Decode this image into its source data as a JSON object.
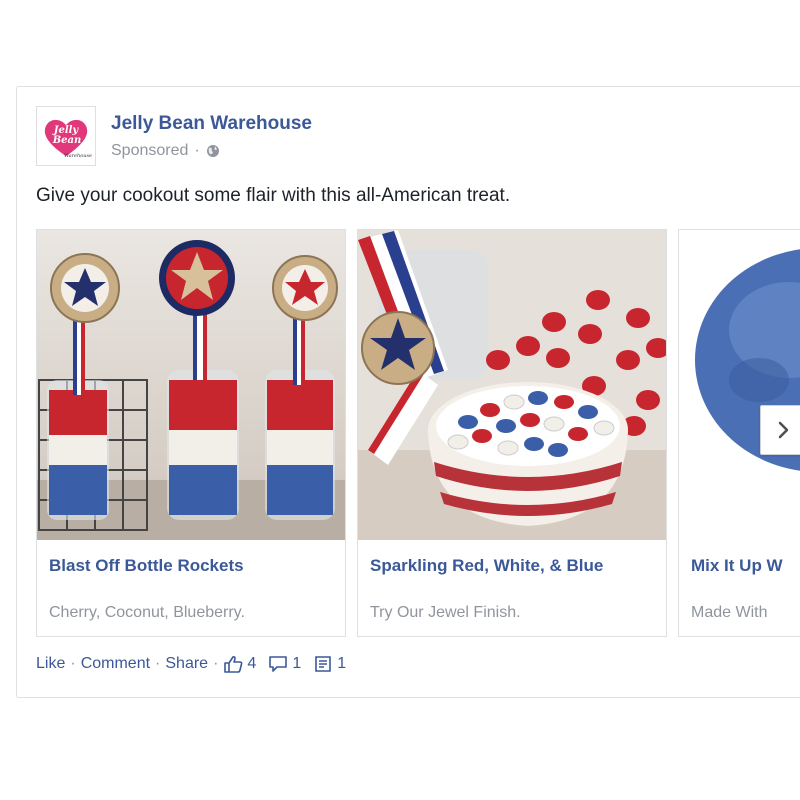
{
  "post": {
    "page_name": "Jelly Bean Warehouse",
    "sponsored": "Sponsored",
    "separator_dot": "·",
    "text": "Give your cookout some flair with this all-American treat.",
    "logo_text": {
      "line1": "Jelly",
      "line2": "Bean",
      "line3": "Warehouse"
    }
  },
  "carousel": {
    "cards": [
      {
        "title": "Blast Off Bottle Rockets",
        "description": "Cherry, Coconut, Blueberry."
      },
      {
        "title": "Sparkling Red, White, & Blue",
        "description": "Try Our Jewel Finish."
      },
      {
        "title": "Mix It Up W",
        "description": "Made With"
      }
    ],
    "next_icon": "chevron-right-icon"
  },
  "actions": {
    "like": "Like",
    "comment": "Comment",
    "share": "Share",
    "separator": "·",
    "likes_count": "4",
    "comments_count": "1",
    "shares_count": "1"
  },
  "colors": {
    "link": "#3b5998",
    "muted": "#90949c",
    "border": "#dddfe2",
    "logo_pink": "#e0387a"
  }
}
